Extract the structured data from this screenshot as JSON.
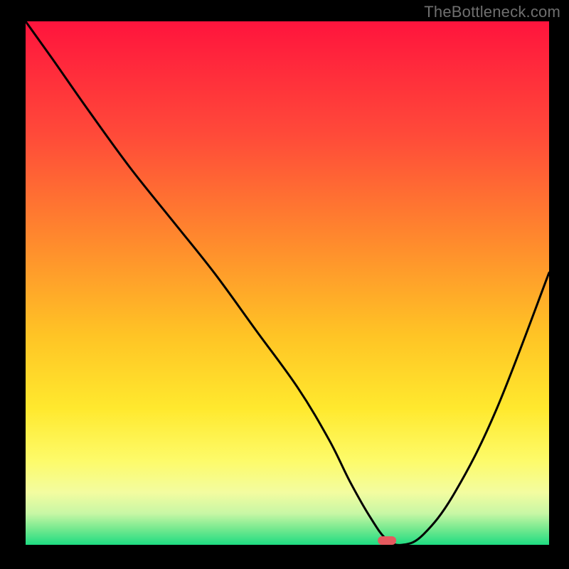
{
  "watermark": "TheBottleneck.com",
  "chart_data": {
    "type": "line",
    "title": "",
    "xlabel": "",
    "ylabel": "",
    "xlim": [
      0,
      100
    ],
    "ylim": [
      0,
      100
    ],
    "x": [
      0,
      5,
      12,
      20,
      28,
      36,
      44,
      52,
      58,
      62,
      66,
      69,
      72,
      76,
      82,
      90,
      100
    ],
    "values": [
      100,
      93,
      83,
      72,
      62,
      52,
      41,
      30,
      20,
      12,
      5,
      1,
      0,
      2,
      10,
      26,
      52
    ],
    "curve_note": "Approximate V-shaped bottleneck curve; minimum around x≈70.",
    "marker": {
      "x": 69,
      "y": 0,
      "width_pct": 3.5
    },
    "background_gradient": {
      "stops": [
        {
          "offset": 0.0,
          "color": "#ff143d"
        },
        {
          "offset": 0.22,
          "color": "#ff4b39"
        },
        {
          "offset": 0.42,
          "color": "#ff8a2d"
        },
        {
          "offset": 0.6,
          "color": "#ffc425"
        },
        {
          "offset": 0.74,
          "color": "#ffe92e"
        },
        {
          "offset": 0.84,
          "color": "#fdfb6a"
        },
        {
          "offset": 0.9,
          "color": "#f3fca0"
        },
        {
          "offset": 0.94,
          "color": "#c8f7a5"
        },
        {
          "offset": 0.97,
          "color": "#74e98f"
        },
        {
          "offset": 1.0,
          "color": "#1edc82"
        }
      ]
    },
    "colors": {
      "curve": "#000000",
      "marker": "#e55a5f",
      "frame_bg": "#000000"
    }
  }
}
